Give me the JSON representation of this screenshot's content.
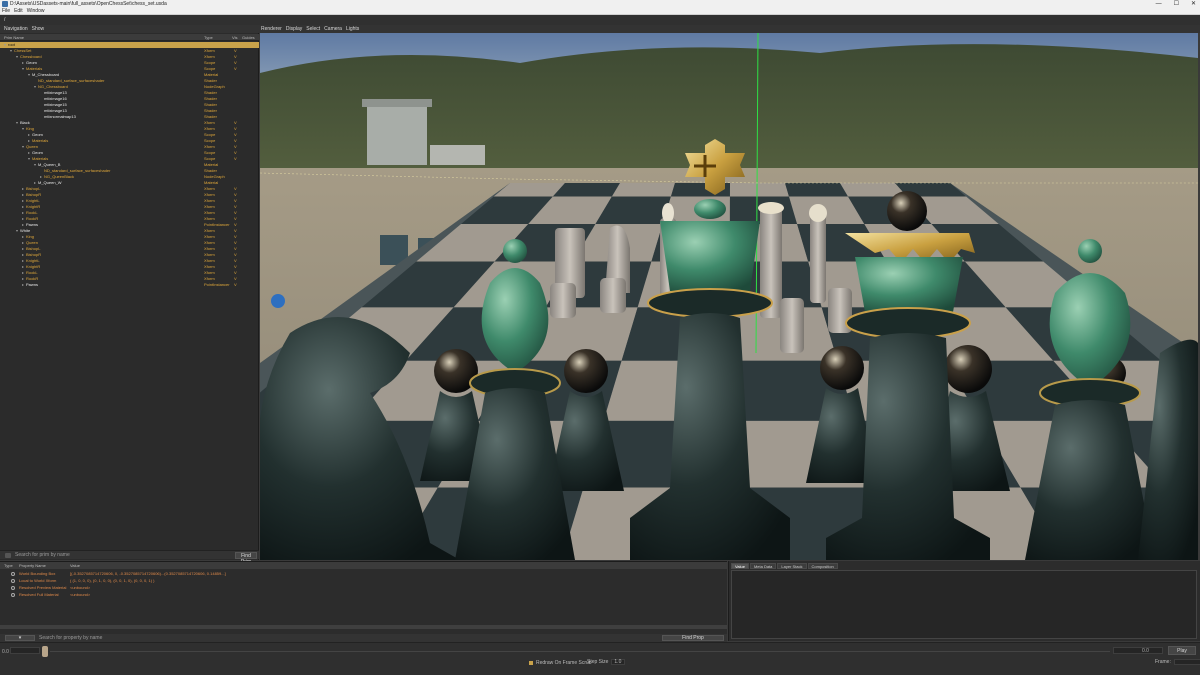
{
  "window": {
    "title": "D:\\Assets\\USDassets-main\\full_assets\\OpenChessSet\\chess_set.usda",
    "controls": [
      "—",
      "☐",
      "✕"
    ]
  },
  "menu": [
    "File",
    "Edit",
    "Window"
  ],
  "path": "/",
  "left": {
    "nav": [
      "Navigation",
      "Show"
    ],
    "columns": {
      "name": "Prim Name",
      "type": "Type",
      "vis": "Vis",
      "guides": "Guides"
    },
    "rows": [
      {
        "name": "root",
        "type": "",
        "vis": "",
        "depth": 0,
        "twisty": "▾",
        "color": "sel"
      },
      {
        "name": "ChessSet",
        "type": "Xform",
        "vis": "V",
        "depth": 1,
        "twisty": "▾",
        "color": "gold"
      },
      {
        "name": "Chessboard",
        "type": "Xform",
        "vis": "V",
        "depth": 2,
        "twisty": "▾",
        "color": "gold"
      },
      {
        "name": "Geom",
        "type": "Scope",
        "vis": "V",
        "depth": 3,
        "twisty": "▸",
        "color": "wht"
      },
      {
        "name": "Materials",
        "type": "Scope",
        "vis": "V",
        "depth": 3,
        "twisty": "▾",
        "color": "gold"
      },
      {
        "name": "M_Chessboard",
        "type": "Material",
        "vis": "",
        "depth": 4,
        "twisty": "▾",
        "color": "wht"
      },
      {
        "name": "ND_standard_surface_surfaceshader",
        "type": "Shader",
        "vis": "",
        "depth": 5,
        "twisty": "",
        "color": "gold"
      },
      {
        "name": "NG_Chessboard",
        "type": "NodeGraph",
        "vis": "",
        "depth": 5,
        "twisty": "▾",
        "color": "gold"
      },
      {
        "name": "mtlximage13",
        "type": "Shader",
        "vis": "",
        "depth": 6,
        "twisty": "",
        "color": "wht"
      },
      {
        "name": "mtlximage16",
        "type": "Shader",
        "vis": "",
        "depth": 6,
        "twisty": "",
        "color": "wht"
      },
      {
        "name": "mtlximage15",
        "type": "Shader",
        "vis": "",
        "depth": 6,
        "twisty": "",
        "color": "wht"
      },
      {
        "name": "mtlximage13",
        "type": "Shader",
        "vis": "",
        "depth": 6,
        "twisty": "",
        "color": "wht"
      },
      {
        "name": "mtlxnormalmap13",
        "type": "Shader",
        "vis": "",
        "depth": 6,
        "twisty": "",
        "color": "wht"
      },
      {
        "name": "Black",
        "type": "Xform",
        "vis": "V",
        "depth": 2,
        "twisty": "▾",
        "color": "wht"
      },
      {
        "name": "King",
        "type": "Xform",
        "vis": "V",
        "depth": 3,
        "twisty": "▾",
        "color": "gold"
      },
      {
        "name": "Geom",
        "type": "Scope",
        "vis": "V",
        "depth": 4,
        "twisty": "▸",
        "color": "wht"
      },
      {
        "name": "Materials",
        "type": "Scope",
        "vis": "V",
        "depth": 4,
        "twisty": "▸",
        "color": "gold"
      },
      {
        "name": "Queen",
        "type": "Xform",
        "vis": "V",
        "depth": 3,
        "twisty": "▾",
        "color": "gold"
      },
      {
        "name": "Geom",
        "type": "Scope",
        "vis": "V",
        "depth": 4,
        "twisty": "▸",
        "color": "wht"
      },
      {
        "name": "Materials",
        "type": "Scope",
        "vis": "V",
        "depth": 4,
        "twisty": "▾",
        "color": "gold"
      },
      {
        "name": "M_Queen_B",
        "type": "Material",
        "vis": "",
        "depth": 5,
        "twisty": "▾",
        "color": "wht"
      },
      {
        "name": "ND_standard_surface_surfaceshader",
        "type": "Shader",
        "vis": "",
        "depth": 6,
        "twisty": "",
        "color": "gold"
      },
      {
        "name": "NG_QueenBlack",
        "type": "NodeGraph",
        "vis": "",
        "depth": 6,
        "twisty": "▸",
        "color": "gold"
      },
      {
        "name": "M_Queen_W",
        "type": "Material",
        "vis": "",
        "depth": 5,
        "twisty": "▸",
        "color": "wht"
      },
      {
        "name": "BishopL",
        "type": "Xform",
        "vis": "V",
        "depth": 3,
        "twisty": "▸",
        "color": "gold"
      },
      {
        "name": "BishopR",
        "type": "Xform",
        "vis": "V",
        "depth": 3,
        "twisty": "▸",
        "color": "gold"
      },
      {
        "name": "KnightL",
        "type": "Xform",
        "vis": "V",
        "depth": 3,
        "twisty": "▸",
        "color": "gold"
      },
      {
        "name": "KnightR",
        "type": "Xform",
        "vis": "V",
        "depth": 3,
        "twisty": "▸",
        "color": "gold"
      },
      {
        "name": "RookL",
        "type": "Xform",
        "vis": "V",
        "depth": 3,
        "twisty": "▸",
        "color": "gold"
      },
      {
        "name": "RookR",
        "type": "Xform",
        "vis": "V",
        "depth": 3,
        "twisty": "▸",
        "color": "gold"
      },
      {
        "name": "Pawns",
        "type": "PointInstancer",
        "vis": "V",
        "depth": 3,
        "twisty": "▸",
        "color": "wht"
      },
      {
        "name": "White",
        "type": "Xform",
        "vis": "V",
        "depth": 2,
        "twisty": "▾",
        "color": "wht"
      },
      {
        "name": "King",
        "type": "Xform",
        "vis": "V",
        "depth": 3,
        "twisty": "▸",
        "color": "gold"
      },
      {
        "name": "Queen",
        "type": "Xform",
        "vis": "V",
        "depth": 3,
        "twisty": "▸",
        "color": "gold"
      },
      {
        "name": "BishopL",
        "type": "Xform",
        "vis": "V",
        "depth": 3,
        "twisty": "▸",
        "color": "gold"
      },
      {
        "name": "BishopR",
        "type": "Xform",
        "vis": "V",
        "depth": 3,
        "twisty": "▸",
        "color": "gold"
      },
      {
        "name": "KnightL",
        "type": "Xform",
        "vis": "V",
        "depth": 3,
        "twisty": "▸",
        "color": "gold"
      },
      {
        "name": "KnightR",
        "type": "Xform",
        "vis": "V",
        "depth": 3,
        "twisty": "▸",
        "color": "gold"
      },
      {
        "name": "RookL",
        "type": "Xform",
        "vis": "V",
        "depth": 3,
        "twisty": "▸",
        "color": "gold"
      },
      {
        "name": "RookR",
        "type": "Xform",
        "vis": "V",
        "depth": 3,
        "twisty": "▸",
        "color": "gold"
      },
      {
        "name": "Pawns",
        "type": "PointInstancer",
        "vis": "V",
        "depth": 3,
        "twisty": "▸",
        "color": "wht"
      }
    ],
    "find_placeholder": "Search for prim by name",
    "find_button": "Find Prim"
  },
  "viewport": {
    "menu": [
      "Renderer",
      "Display",
      "Select",
      "Camera",
      "Lights"
    ]
  },
  "properties": {
    "columns": {
      "type": "Type",
      "name": "Property Name",
      "value": "Value"
    },
    "rows": [
      {
        "name": "World Bounding Box",
        "value": "[(-0.3527085714720606, 0, -0.3527085714720606)...(0.3527085714720606, 0.14859...]"
      },
      {
        "name": "Local to World Xform",
        "value": "( (1, 0, 0, 0), (0, 1, 0, 0), (0, 0, 1, 0), (0, 0, 0, 1) )"
      },
      {
        "name": "Resolved Preview Material",
        "value": "<unbound>"
      },
      {
        "name": "Resolved Full Material",
        "value": "<unbound>"
      }
    ],
    "find_placeholder": "Search for property by name",
    "find_button": "Find Prop"
  },
  "tabs": [
    {
      "label": "Value",
      "active": true
    },
    {
      "label": "Meta Data",
      "active": false
    },
    {
      "label": "Layer Stack",
      "active": false
    },
    {
      "label": "Composition",
      "active": false
    }
  ],
  "timeline": {
    "start": "0.0",
    "end": "0.0",
    "play": "Play",
    "redraw_label": "Redraw On Frame Scrub",
    "step_label": "Step Size",
    "step_value": "1.0",
    "frame_label": "Frame:"
  },
  "colors": {
    "accent": "#c9a24a",
    "orange_text": "#e0a83a",
    "property_text": "#e08a4a"
  }
}
